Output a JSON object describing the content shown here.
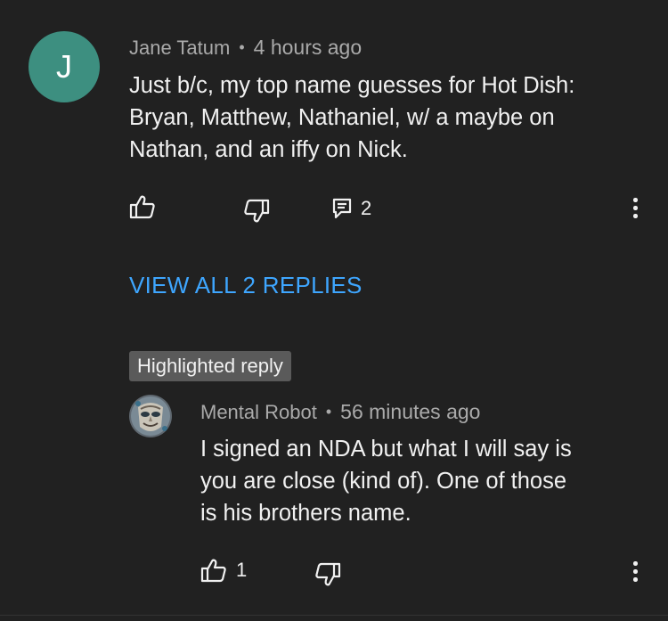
{
  "comment": {
    "avatar_letter": "J",
    "author": "Jane Tatum",
    "separator": "•",
    "time": "4 hours ago",
    "text_lines": [
      "Just b/c, my top name guesses for Hot Dish:",
      "Bryan, Matthew, Nathaniel, w/ a maybe on",
      "Nathan, and an iffy on Nick."
    ],
    "reply_count": "2",
    "avatar_color": "#3d8f80"
  },
  "view_replies": "VIEW ALL 2 REPLIES",
  "highlight_badge": "Highlighted reply",
  "reply": {
    "author": "Mental Robot",
    "separator": "•",
    "time": "56 minutes ago",
    "text_lines": [
      "I signed an NDA but what I will say is",
      "you are close (kind of). One of those",
      "is his brothers name."
    ],
    "like_count": "1"
  },
  "colors": {
    "background": "#212121",
    "link": "#3ea6ff",
    "meta": "#aaaaaa",
    "text": "#f1f1f1"
  },
  "icons": [
    "thumbs-up-icon",
    "thumbs-down-icon",
    "reply-comment-icon",
    "more-vert-icon"
  ]
}
